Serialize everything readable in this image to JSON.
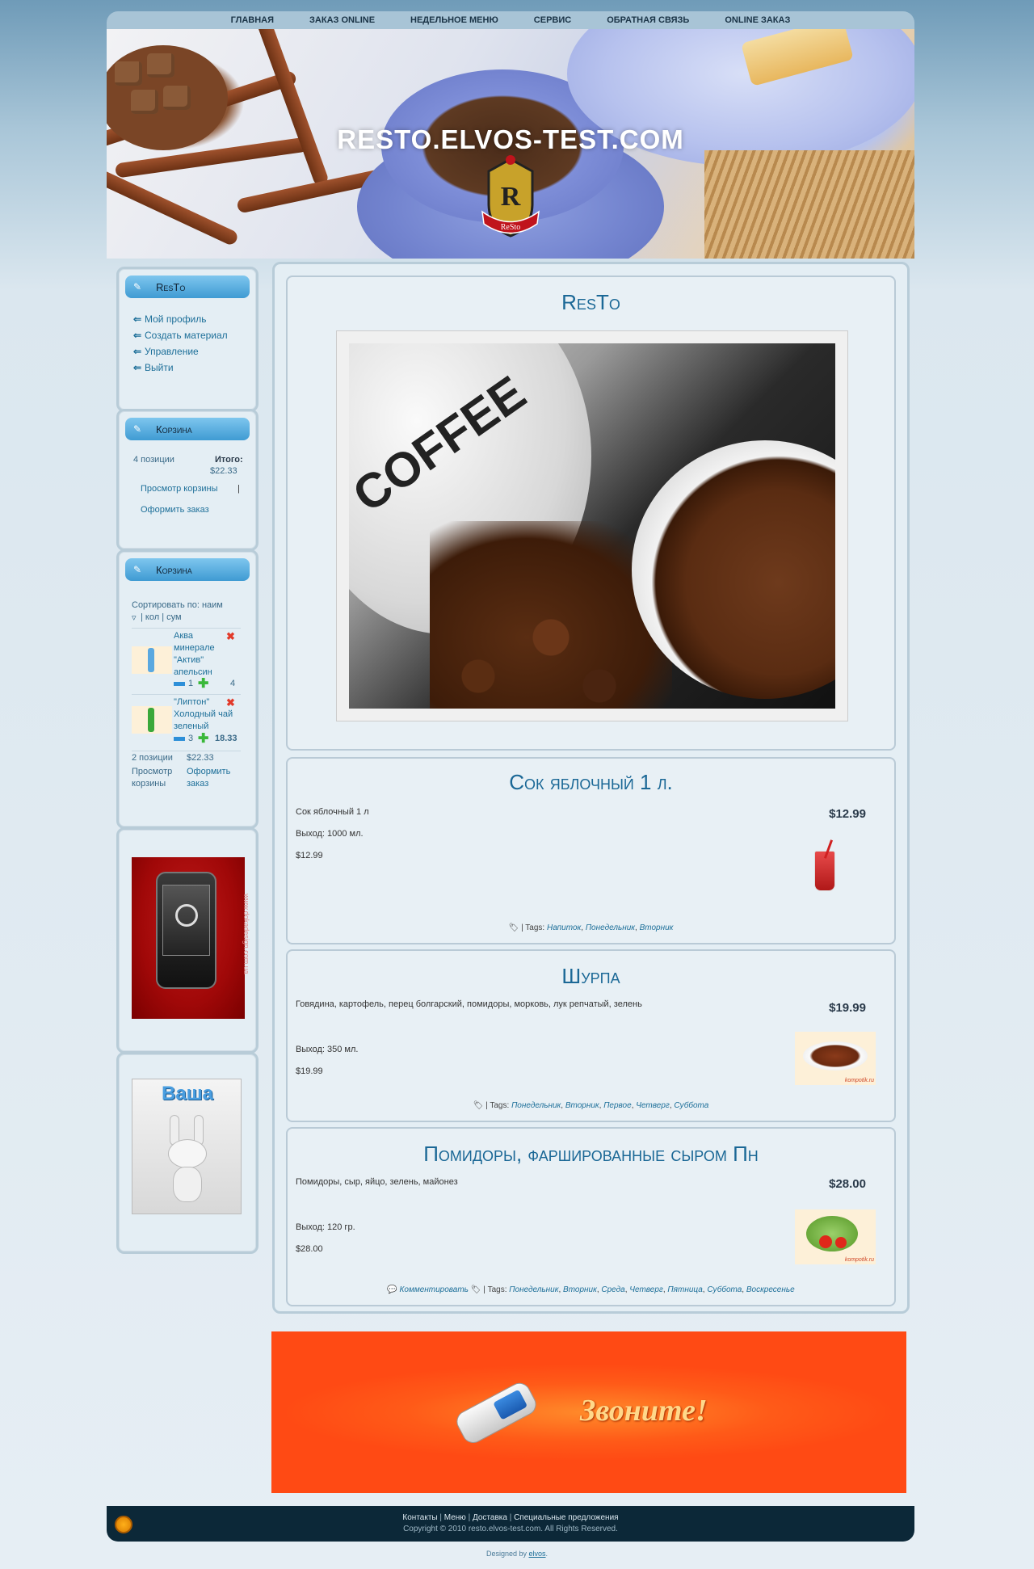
{
  "nav": [
    "Главная",
    "Заказ online",
    "Недельное меню",
    "Сервис",
    "Обратная связь",
    "Online заказ"
  ],
  "site_title": "RESTO.ELVOS-TEST.COM",
  "logo_text": "ReSto",
  "user_menu": {
    "title": "ResTo",
    "items": [
      "Мой профиль",
      "Создать материал",
      "Управление",
      "Выйти"
    ]
  },
  "cart_summary": {
    "title": "Корзина",
    "count": "4 позиции",
    "total_label": "Итого:",
    "total": "$22.33",
    "view_cart": "Просмотр корзины",
    "separator": "|",
    "checkout": "Оформить заказ"
  },
  "cart_detail": {
    "title": "Корзина",
    "sort_label": "Сортировать по: наим",
    "sort_opts": "| кол | сум",
    "items": [
      {
        "name": "Аква минерале \"Актив\" апельсин",
        "qty": "1",
        "sum": "4"
      },
      {
        "name": "\"Липтон\" Холодный чай зеленый",
        "qty": "3",
        "sum": "18.33"
      }
    ],
    "count": "2 позиции",
    "total": "$22.33",
    "view_cart": "Просмотр корзины",
    "checkout": "Оформить заказ"
  },
  "ad_phone_text": "www.dokadesign.com.ua",
  "ad_bunny_text": "Ваша",
  "featured": {
    "title": "ResTo",
    "image_text": "COFFEE"
  },
  "products": [
    {
      "title": "Сок яблочный 1 л.",
      "desc": "Сок яблочный 1 л",
      "yield": "Выход: 1000 мл.",
      "price_small": "$12.99",
      "price": "$12.99",
      "tags_prefix": "| Tags:",
      "tags": [
        "Напиток",
        "Понедельник",
        "Вторник"
      ]
    },
    {
      "title": "Шурпа",
      "desc": "Говядина, картофель, перец болгарский, помидоры, морковь, лук репчатый, зелень",
      "yield": "Выход: 350 мл.",
      "price_small": "$19.99",
      "price": "$19.99",
      "tags_prefix": "| Tags:",
      "tags": [
        "Понедельник",
        "Вторник",
        "Первое",
        "Четверг",
        "Суббота"
      ],
      "img_label": "kompotik.ru"
    },
    {
      "title": "Помидоры, фаршированные сыром Пн",
      "desc": "Помидоры, сыр, яйцо, зелень, майонез",
      "yield": "Выход: 120 гр.",
      "price_small": "$28.00",
      "price": "$28.00",
      "comment": "Комментировать",
      "tags_prefix": "| Tags:",
      "tags": [
        "Понедельник",
        "Вторник",
        "Среда",
        "Четверг",
        "Пятница",
        "Суббота",
        "Воскресенье"
      ],
      "img_label": "kompotik.ru"
    }
  ],
  "banner_text": "Звоните!",
  "footer": {
    "links": [
      "Контакты",
      "Меню",
      "Доставка",
      "Специальные предложения"
    ],
    "copyright": "Copyright © 2010 resto.elvos-test.com. All Rights Reserved.",
    "designed_prefix": "Designed by",
    "designed_link": "elvos",
    "designed_suffix": "."
  },
  "colors": {
    "accent": "#1b6896",
    "footer_bg": "#0c2838",
    "banner_bg": "#ff4a14"
  }
}
